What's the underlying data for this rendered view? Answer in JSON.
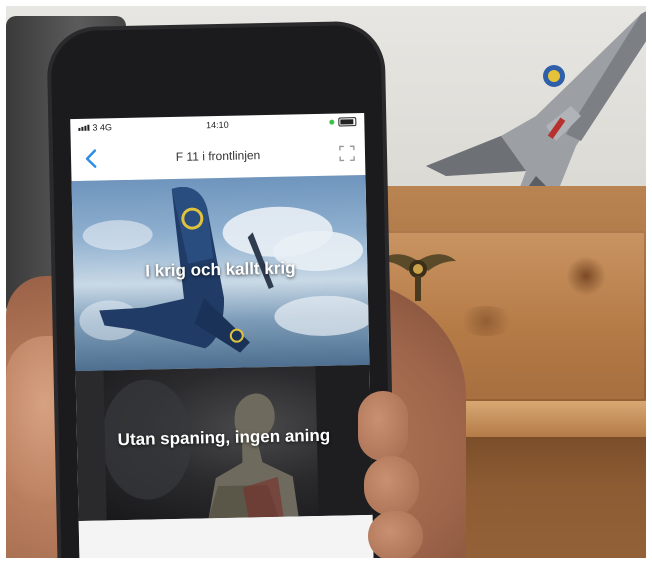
{
  "status_bar": {
    "carrier": "3 4G",
    "time": "14:10"
  },
  "nav": {
    "title": "F 11 i frontlinjen",
    "back_icon": "chevron-left-icon",
    "expand_icon": "fullscreen-icon"
  },
  "cards": [
    {
      "title": "I krig och kallt krig"
    },
    {
      "title": "Utan spaning, ingen aning"
    }
  ],
  "colors": {
    "accent": "#2f8dea",
    "status_dot": "#3cc24a"
  }
}
